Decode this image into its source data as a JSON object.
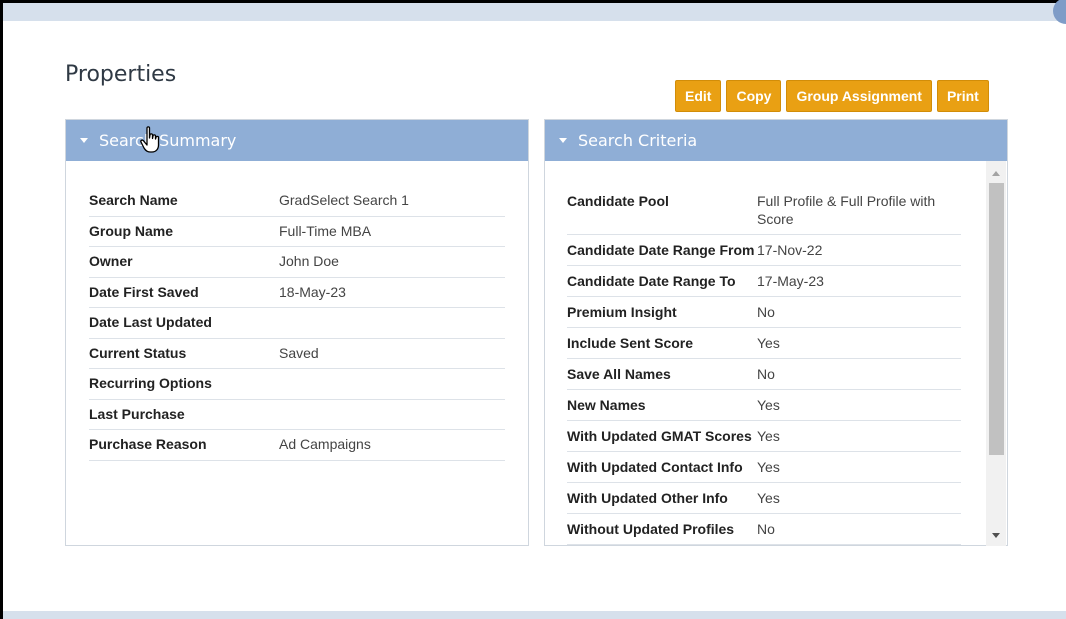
{
  "page": {
    "title": "Properties"
  },
  "toolbar": {
    "edit_label": "Edit",
    "copy_label": "Copy",
    "group_assignment_label": "Group Assignment",
    "print_label": "Print"
  },
  "search_summary": {
    "header": "Search Summary",
    "rows": [
      {
        "label": "Search Name",
        "value": "GradSelect Search 1"
      },
      {
        "label": "Group Name",
        "value": "Full-Time MBA"
      },
      {
        "label": "Owner",
        "value": "John Doe"
      },
      {
        "label": "Date First Saved",
        "value": "18-May-23"
      },
      {
        "label": "Date Last Updated",
        "value": ""
      },
      {
        "label": "Current Status",
        "value": "Saved"
      },
      {
        "label": "Recurring Options",
        "value": ""
      },
      {
        "label": "Last Purchase",
        "value": ""
      },
      {
        "label": "Purchase Reason",
        "value": "Ad Campaigns"
      }
    ]
  },
  "search_criteria": {
    "header": "Search Criteria",
    "rows": [
      {
        "label": "Candidate Pool",
        "value": "Full Profile & Full Profile with Score"
      },
      {
        "label": "Candidate Date Range From",
        "value": "17-Nov-22"
      },
      {
        "label": "Candidate Date Range To",
        "value": "17-May-23"
      },
      {
        "label": "Premium Insight",
        "value": "No"
      },
      {
        "label": "Include Sent Score",
        "value": "Yes"
      },
      {
        "label": "Save All Names",
        "value": "No"
      },
      {
        "label": "New Names",
        "value": "Yes"
      },
      {
        "label": "With Updated GMAT Scores",
        "value": "Yes"
      },
      {
        "label": "With Updated Contact Info",
        "value": "Yes"
      },
      {
        "label": "With Updated Other Info",
        "value": "Yes"
      },
      {
        "label": "Without Updated Profiles",
        "value": "No"
      }
    ]
  },
  "colors": {
    "button": "#e9a013",
    "panel_header": "#8faed6",
    "strip": "#d6e0ec"
  }
}
